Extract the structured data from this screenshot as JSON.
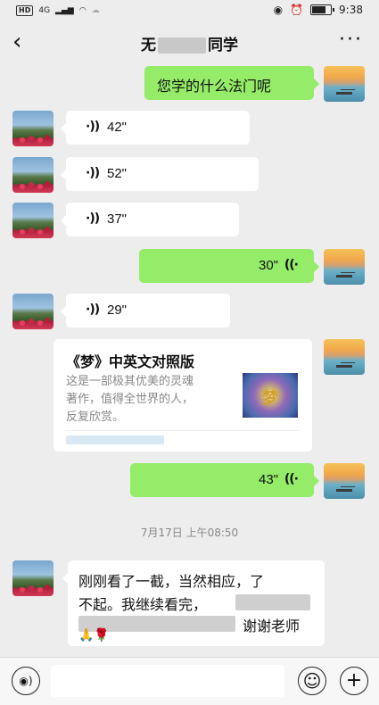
{
  "status_bar": {
    "network": "4G",
    "time": "9:38"
  },
  "header": {
    "back_icon": "‹",
    "title_prefix": "无",
    "title_suffix": "同学",
    "more_icon": "···"
  },
  "messages": {
    "m1": {
      "text": "您学的什么法门呢"
    },
    "m2": {
      "duration": "42\""
    },
    "m3": {
      "duration": "52\""
    },
    "m4": {
      "duration": "37\""
    },
    "m5": {
      "duration": "30\""
    },
    "m6": {
      "duration": "29\""
    },
    "card": {
      "title": "《梦》中英文对照版",
      "desc_lines": [
        "这是一部极其优美的灵魂",
        "著作，值得全世界的人，",
        "反复欣赏。"
      ],
      "thumb_char": "梦"
    },
    "m8": {
      "duration": "43\""
    },
    "timestamp": "7月17日 上午08:50",
    "text_msg": {
      "line1": "刚刚看了一截，当然相应，了",
      "line2": "不起。我继续看完，",
      "line3_tail": "谢谢老师",
      "emoji": "🙏🌹"
    }
  },
  "bottom_bar": {
    "voice_icon": "◉)",
    "emoji_icon": "☺",
    "plus_icon": "+"
  }
}
